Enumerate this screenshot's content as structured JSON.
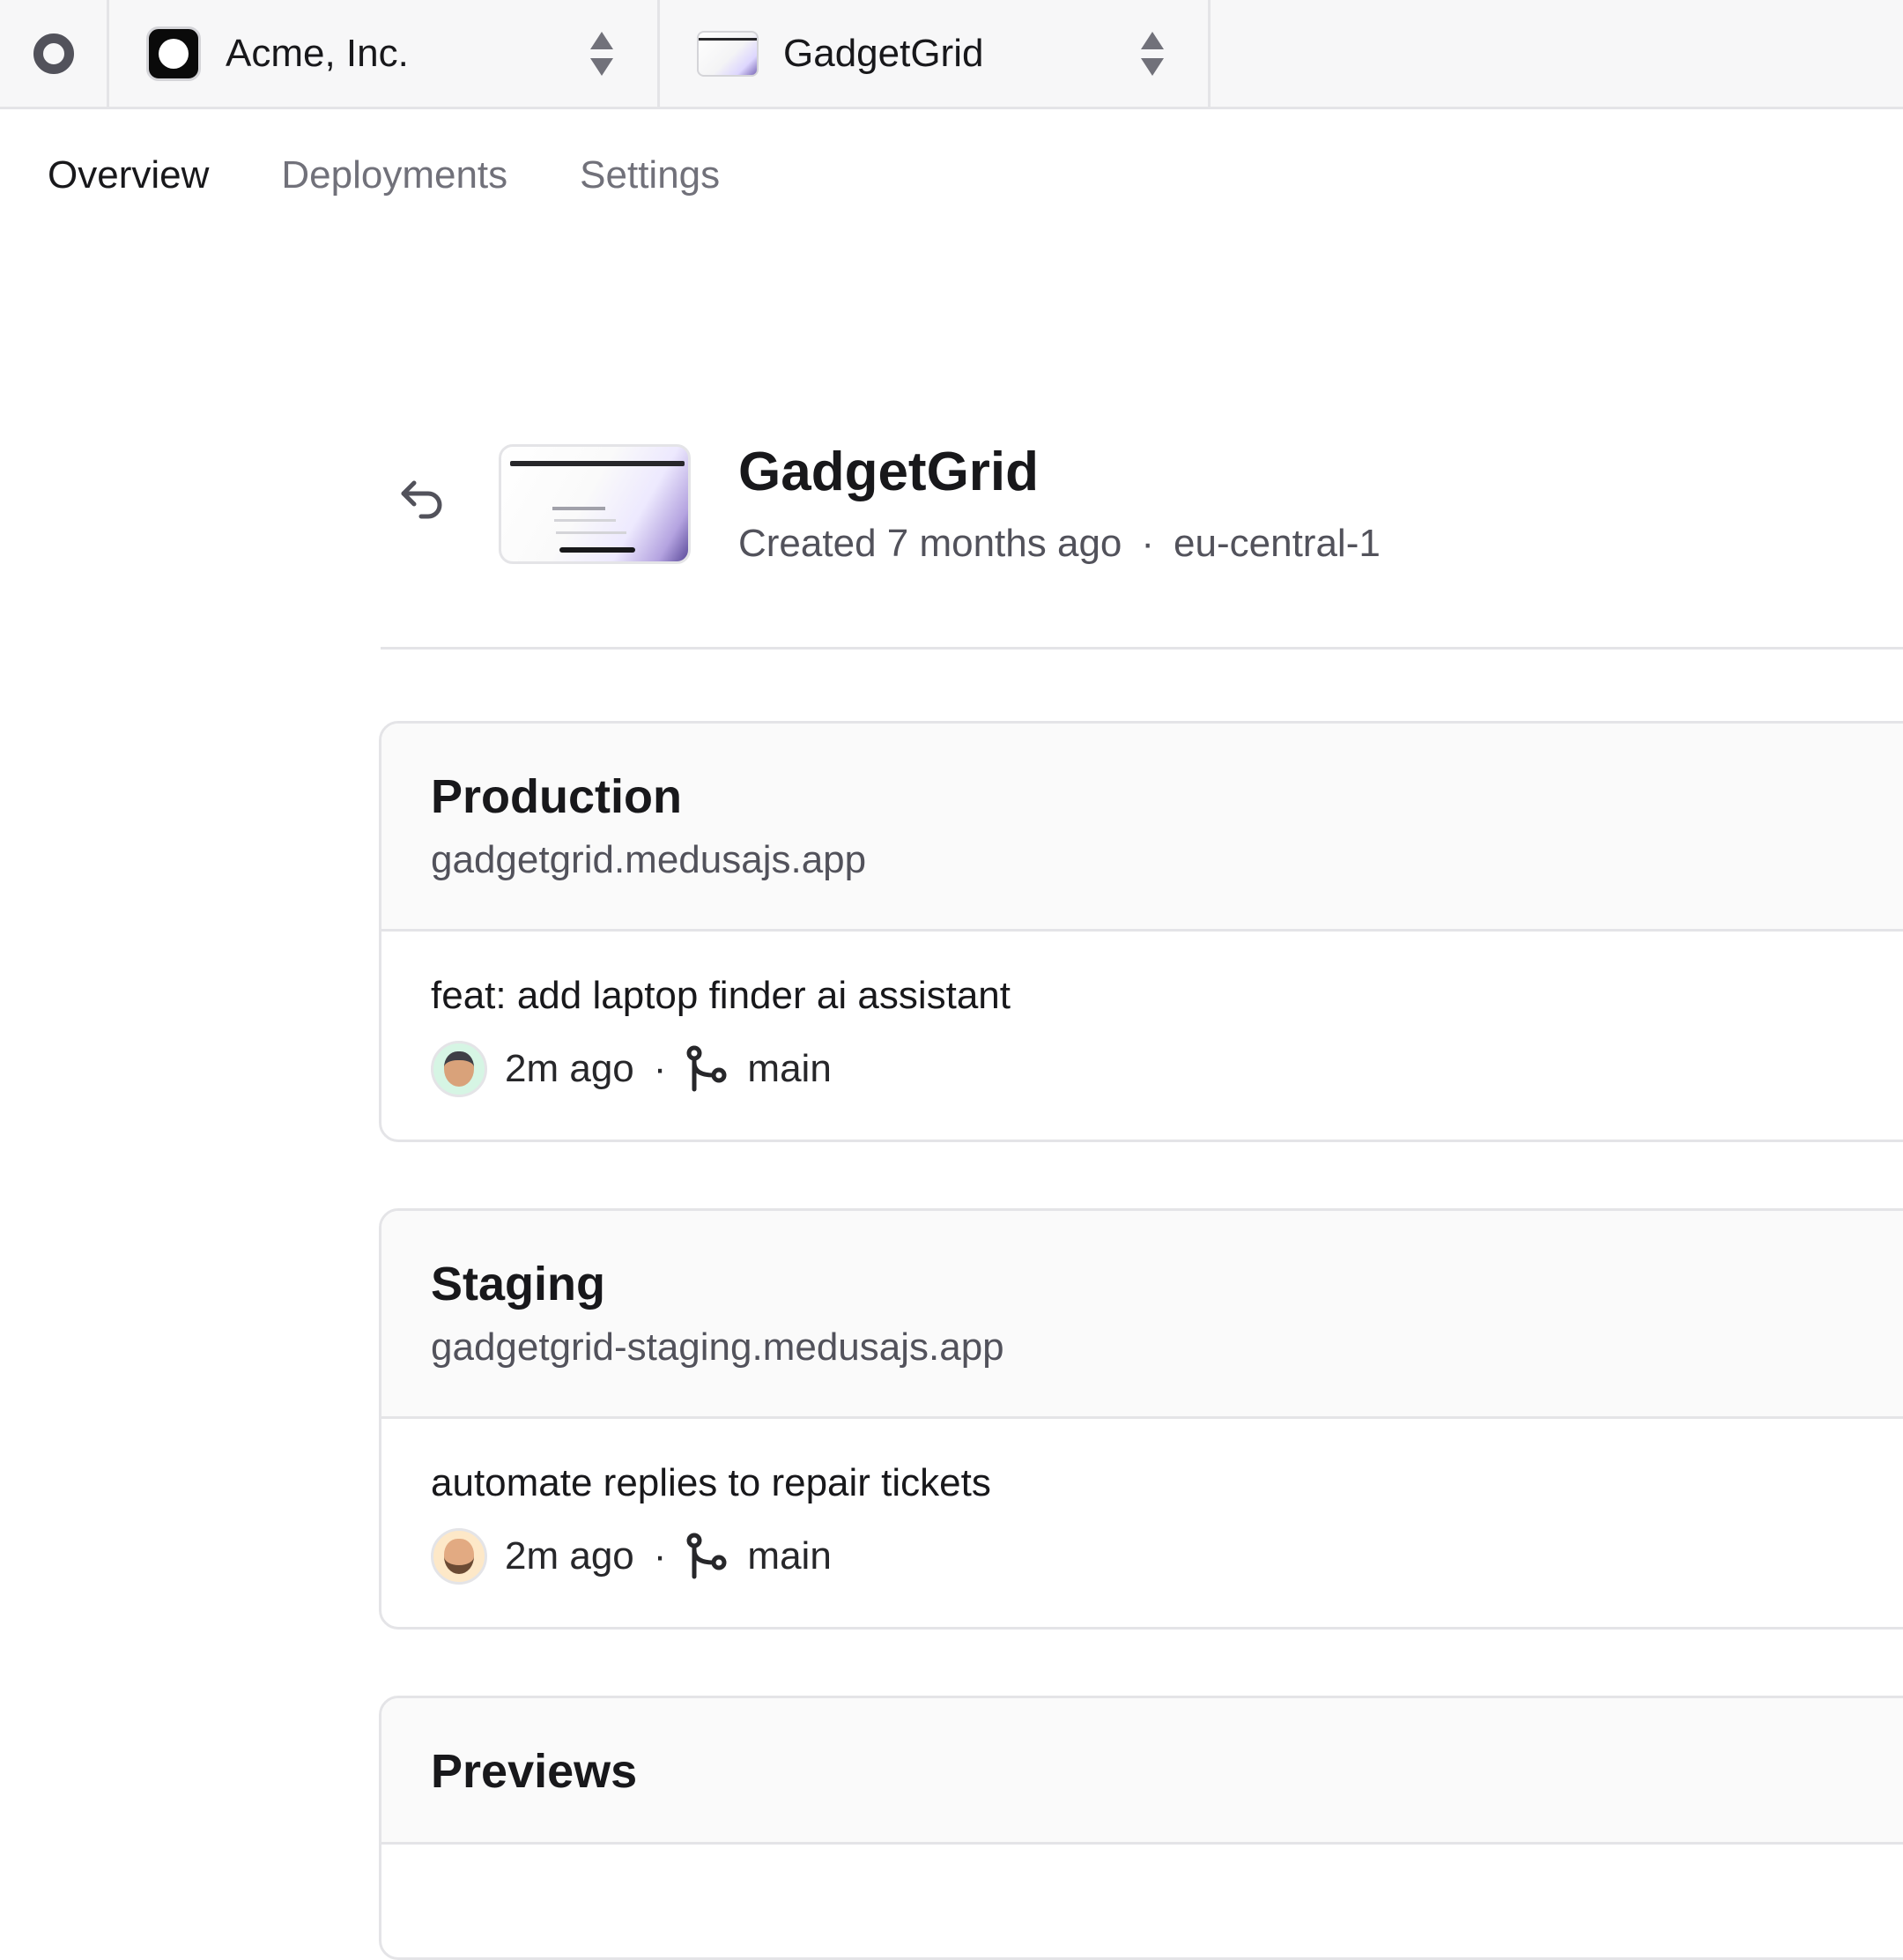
{
  "topbar": {
    "org_name": "Acme, Inc.",
    "project_name": "GadgetGrid"
  },
  "tabs": [
    {
      "label": "Overview",
      "active": true
    },
    {
      "label": "Deployments",
      "active": false
    },
    {
      "label": "Settings",
      "active": false
    }
  ],
  "project": {
    "title": "GadgetGrid",
    "created": "Created 7 months ago",
    "separator": "·",
    "region": "eu-central-1"
  },
  "environments": [
    {
      "title": "Production",
      "url": "gadgetgrid.medusajs.app",
      "commit_message": "feat: add laptop finder ai assistant",
      "time": "2m ago",
      "separator": "·",
      "branch": "main"
    },
    {
      "title": "Staging",
      "url": "gadgetgrid-staging.medusajs.app",
      "commit_message": "automate replies to repair tickets",
      "time": "2m ago",
      "separator": "·",
      "branch": "main"
    },
    {
      "title": "Previews"
    }
  ],
  "icons": {
    "logo": "ring-logo-icon",
    "selector": "chevron-up-down-icon",
    "back": "undo-arrow-icon",
    "branch": "git-branch-icon"
  },
  "colors": {
    "text_primary": "#18181b",
    "text_secondary": "#52525b",
    "border": "#e4e4e7",
    "surface": "#fafafa"
  }
}
